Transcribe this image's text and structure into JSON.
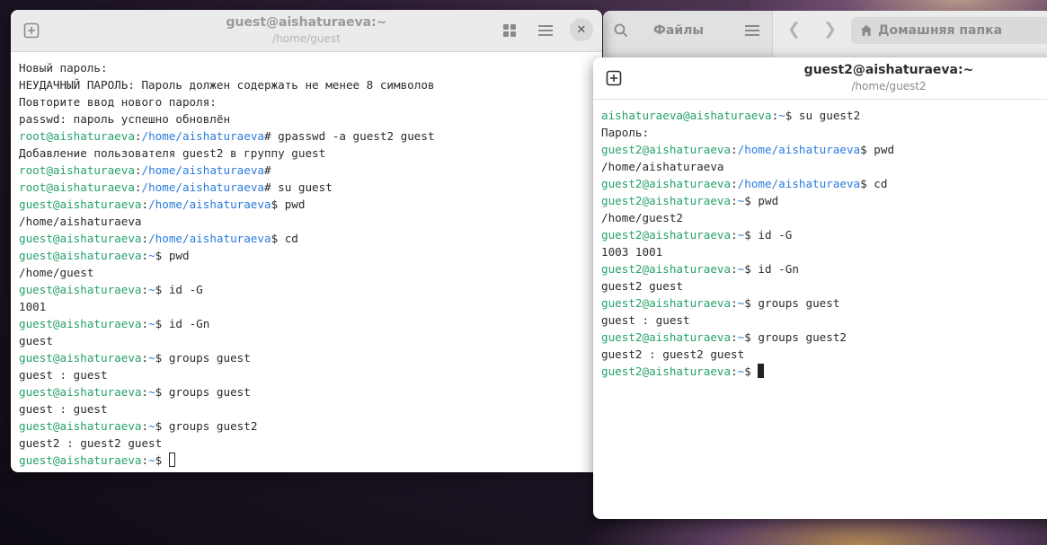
{
  "files_window": {
    "sidebar_title": "Файлы",
    "location": "Домашняя папка"
  },
  "terminal1": {
    "title": "guest@aishaturaeva:~",
    "subtitle": "/home/guest",
    "lines": [
      [
        {
          "t": "Новый пароль:",
          "c": ""
        }
      ],
      [
        {
          "t": "НЕУДАЧНЫЙ ПАРОЛЬ: Пароль должен содержать не менее 8 символов",
          "c": ""
        }
      ],
      [
        {
          "t": "Повторите ввод нового пароля:",
          "c": ""
        }
      ],
      [
        {
          "t": "passwd: пароль успешно обновлён",
          "c": ""
        }
      ],
      [
        {
          "t": "root@aishaturaeva",
          "c": "user"
        },
        {
          "t": ":",
          "c": ""
        },
        {
          "t": "/home/aishaturaeva",
          "c": "path"
        },
        {
          "t": "# gpasswd -a guest2 guest",
          "c": ""
        }
      ],
      [
        {
          "t": "Добавление пользователя guest2 в группу guest",
          "c": ""
        }
      ],
      [
        {
          "t": "root@aishaturaeva",
          "c": "user"
        },
        {
          "t": ":",
          "c": ""
        },
        {
          "t": "/home/aishaturaeva",
          "c": "path"
        },
        {
          "t": "#",
          "c": ""
        }
      ],
      [
        {
          "t": "root@aishaturaeva",
          "c": "user"
        },
        {
          "t": ":",
          "c": ""
        },
        {
          "t": "/home/aishaturaeva",
          "c": "path"
        },
        {
          "t": "# su guest",
          "c": ""
        }
      ],
      [
        {
          "t": "guest@aishaturaeva",
          "c": "user"
        },
        {
          "t": ":",
          "c": ""
        },
        {
          "t": "/home/aishaturaeva",
          "c": "path"
        },
        {
          "t": "$ pwd",
          "c": ""
        }
      ],
      [
        {
          "t": "/home/aishaturaeva",
          "c": ""
        }
      ],
      [
        {
          "t": "guest@aishaturaeva",
          "c": "user"
        },
        {
          "t": ":",
          "c": ""
        },
        {
          "t": "/home/aishaturaeva",
          "c": "path"
        },
        {
          "t": "$ cd",
          "c": ""
        }
      ],
      [
        {
          "t": "guest@aishaturaeva",
          "c": "user"
        },
        {
          "t": ":",
          "c": ""
        },
        {
          "t": "~",
          "c": "path"
        },
        {
          "t": "$ pwd",
          "c": ""
        }
      ],
      [
        {
          "t": "/home/guest",
          "c": ""
        }
      ],
      [
        {
          "t": "guest@aishaturaeva",
          "c": "user"
        },
        {
          "t": ":",
          "c": ""
        },
        {
          "t": "~",
          "c": "path"
        },
        {
          "t": "$ id -G",
          "c": ""
        }
      ],
      [
        {
          "t": "1001",
          "c": ""
        }
      ],
      [
        {
          "t": "guest@aishaturaeva",
          "c": "user"
        },
        {
          "t": ":",
          "c": ""
        },
        {
          "t": "~",
          "c": "path"
        },
        {
          "t": "$ id -Gn",
          "c": ""
        }
      ],
      [
        {
          "t": "guest",
          "c": ""
        }
      ],
      [
        {
          "t": "guest@aishaturaeva",
          "c": "user"
        },
        {
          "t": ":",
          "c": ""
        },
        {
          "t": "~",
          "c": "path"
        },
        {
          "t": "$ groups guest",
          "c": ""
        }
      ],
      [
        {
          "t": "guest : guest",
          "c": ""
        }
      ],
      [
        {
          "t": "guest@aishaturaeva",
          "c": "user"
        },
        {
          "t": ":",
          "c": ""
        },
        {
          "t": "~",
          "c": "path"
        },
        {
          "t": "$ groups guest",
          "c": ""
        }
      ],
      [
        {
          "t": "guest : guest",
          "c": ""
        }
      ],
      [
        {
          "t": "guest@aishaturaeva",
          "c": "user"
        },
        {
          "t": ":",
          "c": ""
        },
        {
          "t": "~",
          "c": "path"
        },
        {
          "t": "$ groups guest2",
          "c": ""
        }
      ],
      [
        {
          "t": "guest2 : guest2 guest",
          "c": ""
        }
      ],
      [
        {
          "t": "guest@aishaturaeva",
          "c": "user"
        },
        {
          "t": ":",
          "c": ""
        },
        {
          "t": "~",
          "c": "path"
        },
        {
          "t": "$ ",
          "c": ""
        },
        {
          "cursor": "hollow"
        }
      ]
    ]
  },
  "terminal2": {
    "title": "guest2@aishaturaeva:~",
    "subtitle": "/home/guest2",
    "lines": [
      [
        {
          "t": "aishaturaeva@aishaturaeva",
          "c": "user"
        },
        {
          "t": ":",
          "c": ""
        },
        {
          "t": "~",
          "c": "path"
        },
        {
          "t": "$ su guest2",
          "c": ""
        }
      ],
      [
        {
          "t": "Пароль:",
          "c": ""
        }
      ],
      [
        {
          "t": "guest2@aishaturaeva",
          "c": "user"
        },
        {
          "t": ":",
          "c": ""
        },
        {
          "t": "/home/aishaturaeva",
          "c": "path"
        },
        {
          "t": "$ pwd",
          "c": ""
        }
      ],
      [
        {
          "t": "/home/aishaturaeva",
          "c": ""
        }
      ],
      [
        {
          "t": "guest2@aishaturaeva",
          "c": "user"
        },
        {
          "t": ":",
          "c": ""
        },
        {
          "t": "/home/aishaturaeva",
          "c": "path"
        },
        {
          "t": "$ cd",
          "c": ""
        }
      ],
      [
        {
          "t": "guest2@aishaturaeva",
          "c": "user"
        },
        {
          "t": ":",
          "c": ""
        },
        {
          "t": "~",
          "c": "path"
        },
        {
          "t": "$ pwd",
          "c": ""
        }
      ],
      [
        {
          "t": "/home/guest2",
          "c": ""
        }
      ],
      [
        {
          "t": "guest2@aishaturaeva",
          "c": "user"
        },
        {
          "t": ":",
          "c": ""
        },
        {
          "t": "~",
          "c": "path"
        },
        {
          "t": "$ id -G",
          "c": ""
        }
      ],
      [
        {
          "t": "1003 1001",
          "c": ""
        }
      ],
      [
        {
          "t": "guest2@aishaturaeva",
          "c": "user"
        },
        {
          "t": ":",
          "c": ""
        },
        {
          "t": "~",
          "c": "path"
        },
        {
          "t": "$ id -Gn",
          "c": ""
        }
      ],
      [
        {
          "t": "guest2 guest",
          "c": ""
        }
      ],
      [
        {
          "t": "guest2@aishaturaeva",
          "c": "user"
        },
        {
          "t": ":",
          "c": ""
        },
        {
          "t": "~",
          "c": "path"
        },
        {
          "t": "$ groups guest",
          "c": ""
        }
      ],
      [
        {
          "t": "guest : guest",
          "c": ""
        }
      ],
      [
        {
          "t": "guest2@aishaturaeva",
          "c": "user"
        },
        {
          "t": ":",
          "c": ""
        },
        {
          "t": "~",
          "c": "path"
        },
        {
          "t": "$ groups guest2",
          "c": ""
        }
      ],
      [
        {
          "t": "guest2 : guest2 guest",
          "c": ""
        }
      ],
      [
        {
          "t": "guest2@aishaturaeva",
          "c": "user"
        },
        {
          "t": ":",
          "c": ""
        },
        {
          "t": "~",
          "c": "path"
        },
        {
          "t": "$ ",
          "c": ""
        },
        {
          "cursor": "block"
        }
      ]
    ]
  },
  "colors": {
    "prompt_user": "#26a269",
    "prompt_path": "#2a7bde",
    "terminal_bg": "#ffffff",
    "header_bg": "#ebebeb"
  }
}
